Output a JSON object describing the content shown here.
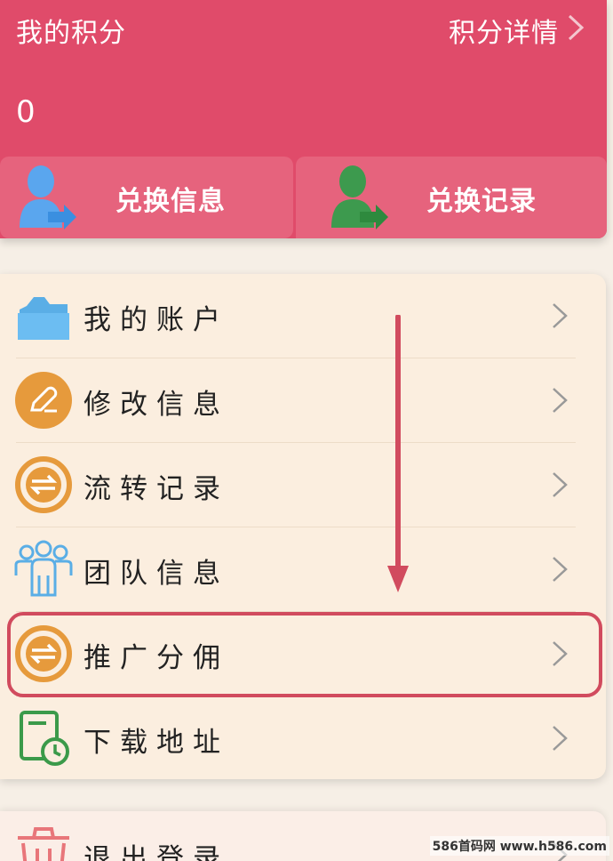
{
  "header": {
    "title": "我的积分",
    "detail_link": "积分详情",
    "points": "0",
    "actions": [
      {
        "label": "兑换信息",
        "icon": "user-exchange-icon"
      },
      {
        "label": "兑换记录",
        "icon": "user-record-icon"
      }
    ]
  },
  "menu": {
    "items": [
      {
        "label": "我的账户",
        "icon": "folder-icon"
      },
      {
        "label": "修改信息",
        "icon": "edit-icon"
      },
      {
        "label": "流转记录",
        "icon": "transfer-icon"
      },
      {
        "label": "团队信息",
        "icon": "team-icon"
      },
      {
        "label": "推广分佣",
        "icon": "transfer-icon"
      },
      {
        "label": "下载地址",
        "icon": "download-clock-icon"
      }
    ]
  },
  "logout": {
    "label": "退出登录",
    "icon": "trash-icon"
  },
  "watermark": "586首码网 www.h586.com",
  "colors": {
    "header": "#e04b6a",
    "action": "#e6637d",
    "card": "#fbeedf",
    "orange": "#e69a3c",
    "blue": "#5aaee6",
    "green": "#3b9a4a",
    "highlight": "#d14b5e"
  }
}
